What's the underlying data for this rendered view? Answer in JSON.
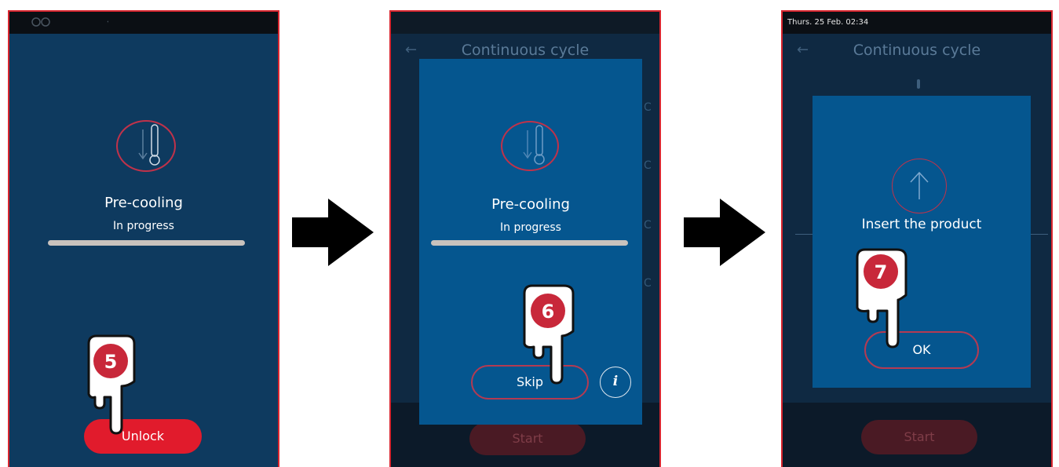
{
  "screen1": {
    "status_icons": [
      "fan-icon",
      "fan-icon",
      "no-wifi-icon"
    ],
    "phase_icon": "thermometer-down-icon",
    "title": "Pre-cooling",
    "subtitle": "In progress",
    "progress": 1.0,
    "button_label": "Unlock",
    "step_number": "5"
  },
  "screen2": {
    "header_title": "Continuous cycle",
    "background_button": "Start",
    "phase_icon": "thermometer-down-icon",
    "title": "Pre-cooling",
    "subtitle": "In progress",
    "progress": 1.0,
    "skip_label": "Skip",
    "info_label": "i",
    "step_number": "6"
  },
  "screen3": {
    "status_text": "Thurs. 25 Feb. 02:34",
    "header_title": "Continuous cycle",
    "background_button": "Start",
    "modal_icon": "arrow-up-icon",
    "message": "Insert the product",
    "ok_label": "OK",
    "step_number": "7"
  },
  "colors": {
    "accent_red": "#e11b2c",
    "modal_blue": "#05568f",
    "screen_blue": "#0e3a5f",
    "frame_red": "#d8262f"
  }
}
